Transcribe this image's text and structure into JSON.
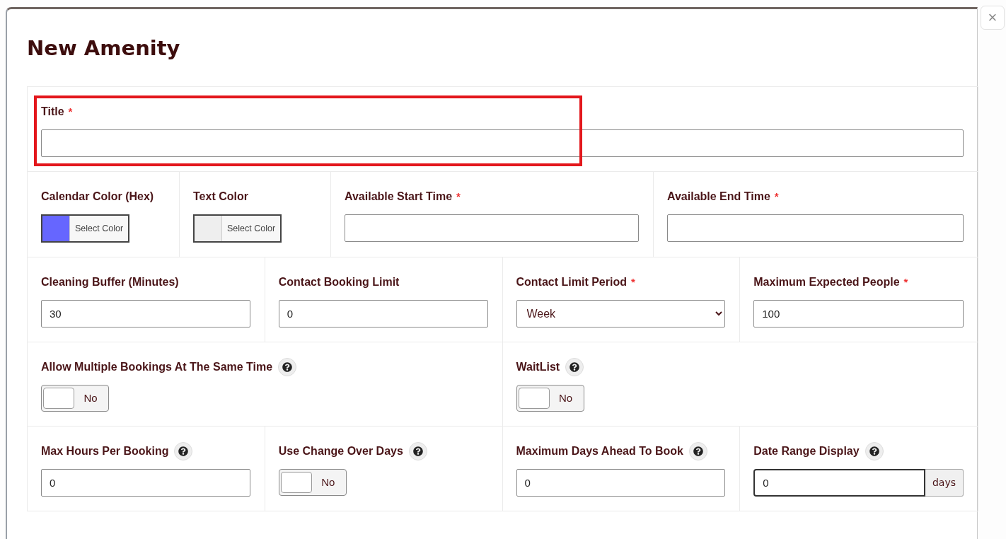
{
  "close": "×",
  "dialog": {
    "title": "New Amenity"
  },
  "form_rows": [
    {
      "fields": [
        {
          "kind": "text",
          "label": "Title",
          "marker": "*",
          "help": false,
          "highlighted": true
        }
      ]
    },
    {
      "fields": [
        {
          "kind": "color",
          "label": "Calendar Color (Hex)",
          "help": false,
          "color": "#6666ff",
          "button": "Select Color"
        },
        {
          "kind": "color",
          "label": "Text Color",
          "help": false,
          "color": "#eeeeee",
          "button": "Select Color"
        },
        {
          "kind": "text",
          "label": "Available Start Time",
          "marker": "*",
          "help": false
        },
        {
          "kind": "text",
          "label": "Available End Time",
          "marker": "*",
          "help": false
        }
      ]
    },
    {
      "fields": [
        {
          "kind": "text",
          "label": "Cleaning Buffer (Minutes)",
          "help": false,
          "value": "30"
        },
        {
          "kind": "text",
          "label": "Contact Booking Limit",
          "help": false,
          "value": "0"
        },
        {
          "kind": "select",
          "label": "Contact Limit Period",
          "marker": "*",
          "help": false,
          "value": "Week"
        },
        {
          "kind": "text",
          "label": "Maximum Expected People",
          "marker": "*",
          "help": false,
          "value": "100"
        }
      ]
    },
    {
      "fields": [
        {
          "kind": "toggle",
          "label": "Allow Multiple Bookings At The Same Time",
          "help": true,
          "on": false,
          "state": "No"
        },
        {
          "kind": "toggle",
          "label": "WaitList",
          "help": true,
          "on": false,
          "state": "No"
        }
      ]
    },
    {
      "fields": [
        {
          "kind": "text",
          "label": "Max Hours Per Booking",
          "help": true,
          "value": "0"
        },
        {
          "kind": "toggle",
          "label": "Use Change Over Days",
          "help": true,
          "on": false,
          "state": "No"
        },
        {
          "kind": "text",
          "label": "Maximum Days Ahead To Book",
          "help": true,
          "value": "0"
        },
        {
          "kind": "addon",
          "label": "Date Range Display",
          "help": true,
          "value": "0",
          "addon": "days",
          "focused": true
        }
      ]
    }
  ]
}
